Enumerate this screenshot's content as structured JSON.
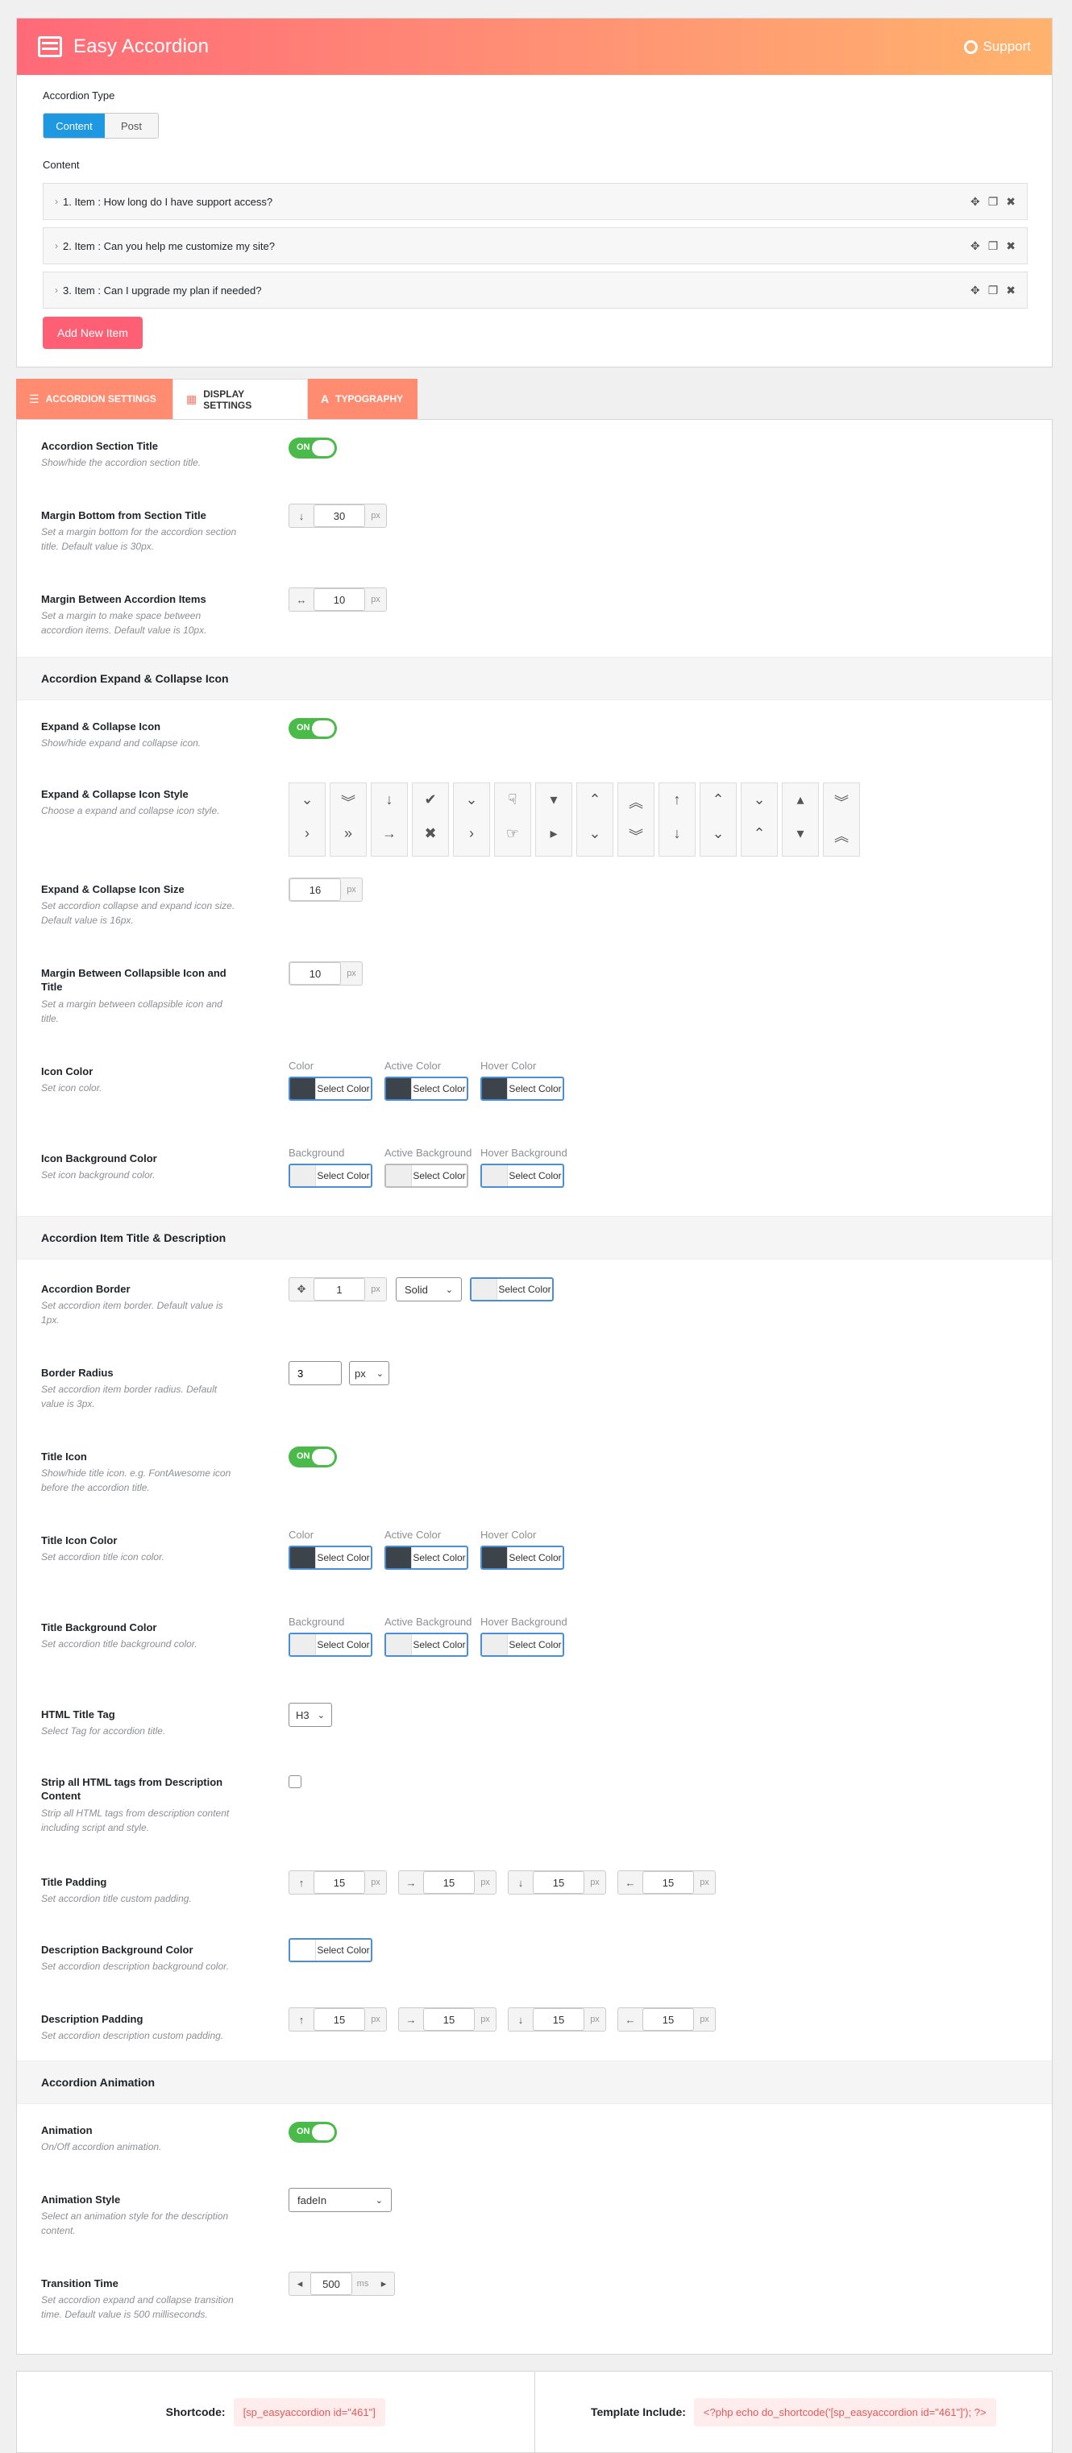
{
  "header": {
    "title": "Easy Accordion",
    "support": "Support"
  },
  "accordion_type": {
    "label": "Accordion Type",
    "options": [
      "Content",
      "Post"
    ],
    "selected": "Content"
  },
  "content": {
    "label": "Content",
    "items": [
      {
        "title": "1. Item : How long do I have support access?"
      },
      {
        "title": "2. Item : Can you help me customize my site?"
      },
      {
        "title": "3. Item : Can I upgrade my plan if needed?"
      }
    ],
    "add_button": "Add New Item"
  },
  "tabs": [
    {
      "label": "ACCORDION SETTINGS",
      "icon": "list-icon"
    },
    {
      "label": "DISPLAY SETTINGS",
      "icon": "grid-icon"
    },
    {
      "label": "TYPOGRAPHY",
      "icon": "font-icon"
    }
  ],
  "toggle_on": "ON",
  "colors": {
    "accent": "#ff6a78",
    "header_end": "#ffb36d",
    "toggle": "#4aba4a",
    "dark_swatch": "#3c434a",
    "light_swatch": "#eeeeee"
  },
  "settings": {
    "section_title": {
      "title": "Accordion Section Title",
      "desc": "Show/hide the accordion section title."
    },
    "margin_bottom": {
      "title": "Margin Bottom from Section Title",
      "desc": "Set a margin bottom for the accordion section title. Default value is 30px.",
      "value": "30",
      "unit": "px"
    },
    "margin_between": {
      "title": "Margin Between Accordion Items",
      "desc": "Set a margin to make space between accordion items. Default value is 10px.",
      "value": "10",
      "unit": "px"
    },
    "sec_expand": "Accordion Expand & Collapse Icon",
    "expand_icon": {
      "title": "Expand & Collapse Icon",
      "desc": "Show/hide expand and collapse icon."
    },
    "icon_style": {
      "title": "Expand & Collapse Icon Style",
      "desc": "Choose a expand and collapse icon style."
    },
    "icon_size": {
      "title": "Expand & Collapse Icon Size",
      "desc": "Set accordion collapse and expand icon size. Default value is 16px.",
      "value": "16",
      "unit": "px"
    },
    "icon_margin": {
      "title": "Margin Between Collapsible Icon and Title",
      "desc": "Set a margin between collapsible icon and title.",
      "value": "10",
      "unit": "px"
    },
    "icon_color": {
      "title": "Icon Color",
      "desc": "Set icon color.",
      "labels": [
        "Color",
        "Active Color",
        "Hover Color"
      ]
    },
    "icon_bg": {
      "title": "Icon Background Color",
      "desc": "Set icon background color.",
      "labels": [
        "Background",
        "Active Background",
        "Hover Background"
      ]
    },
    "select_color": "Select Color",
    "sec_item": "Accordion Item Title & Description",
    "border": {
      "title": "Accordion Border",
      "desc": "Set accordion item border. Default value is 1px.",
      "value": "1",
      "unit": "px",
      "style": "Solid"
    },
    "radius": {
      "title": "Border Radius",
      "desc": "Set accordion item border radius. Default value is 3px.",
      "value": "3",
      "unit": "px"
    },
    "title_icon": {
      "title": "Title Icon",
      "desc": "Show/hide title icon. e.g. FontAwesome icon before the accordion title."
    },
    "title_icon_color": {
      "title": "Title Icon Color",
      "desc": "Set accordion title icon color.",
      "labels": [
        "Color",
        "Active Color",
        "Hover Color"
      ]
    },
    "title_bg": {
      "title": "Title Background Color",
      "desc": "Set accordion title background color.",
      "labels": [
        "Background",
        "Active Background",
        "Hover Background"
      ]
    },
    "html_tag": {
      "title": "HTML Title Tag",
      "desc": "Select Tag for accordion title.",
      "value": "H3"
    },
    "strip": {
      "title": "Strip all HTML tags from Description Content",
      "desc": "Strip all HTML tags from description content including script and style."
    },
    "title_padding": {
      "title": "Title Padding",
      "desc": "Set accordion title custom padding.",
      "values": [
        "15",
        "15",
        "15",
        "15"
      ],
      "unit": "px"
    },
    "desc_bg": {
      "title": "Description Background Color",
      "desc": "Set accordion description background color."
    },
    "desc_padding": {
      "title": "Description Padding",
      "desc": "Set accordion description custom padding.",
      "values": [
        "15",
        "15",
        "15",
        "15"
      ],
      "unit": "px"
    },
    "sec_anim": "Accordion Animation",
    "animation": {
      "title": "Animation",
      "desc": "On/Off accordion animation."
    },
    "anim_style": {
      "title": "Animation Style",
      "desc": "Select an animation style for the description content.",
      "value": "fadeIn"
    },
    "transition": {
      "title": "Transition Time",
      "desc": "Set accordion expand and collapse transition time. Default value is 500 milliseconds.",
      "value": "500",
      "unit": "ms"
    }
  },
  "footer": {
    "shortcode_label": "Shortcode:",
    "shortcode": "[sp_easyaccordion id=\"461\"]",
    "template_label": "Template Include:",
    "template": "<?php echo do_shortcode('[sp_easyaccordion id=\"461\"]'); ?>"
  }
}
